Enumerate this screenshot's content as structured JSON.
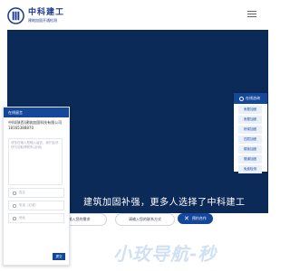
{
  "brand": {
    "name": "中科建工",
    "subtitle": "建筑加固开通检测"
  },
  "hero": {
    "slogan": "建筑加固补强，更多人选择了中科建工",
    "bg_color": "#0c2a57"
  },
  "search": {
    "placeholder_1": "请输入您的需求",
    "placeholder_2": "请输入您的联系方式",
    "submit_label": "预约合作",
    "submit_icon": "tools-icon"
  },
  "watermark": "小玫导航-秒",
  "chat": {
    "header": "在线留言",
    "company": "中科(陕西)建筑加固科技有限公司",
    "phone": "18165388870",
    "message_placeholder": "请您在输入框输入留言，我们会尽快与您取得联系(必填)",
    "fields": [
      {
        "icon": "user-icon",
        "placeholder": "姓名"
      },
      {
        "icon": "phone-icon",
        "placeholder": "电话（必填）"
      },
      {
        "icon": "location-icon",
        "placeholder": "地址"
      }
    ],
    "submit": "提交"
  },
  "quick_panel": {
    "title": "在线咨询",
    "items": [
      "房屋加固",
      "房屋加固",
      "桥梁加固",
      "四层加固",
      "楼板加固",
      "隧道加固",
      "免费检测"
    ]
  },
  "colors": {
    "primary": "#14479a",
    "hero": "#0c2a57"
  }
}
